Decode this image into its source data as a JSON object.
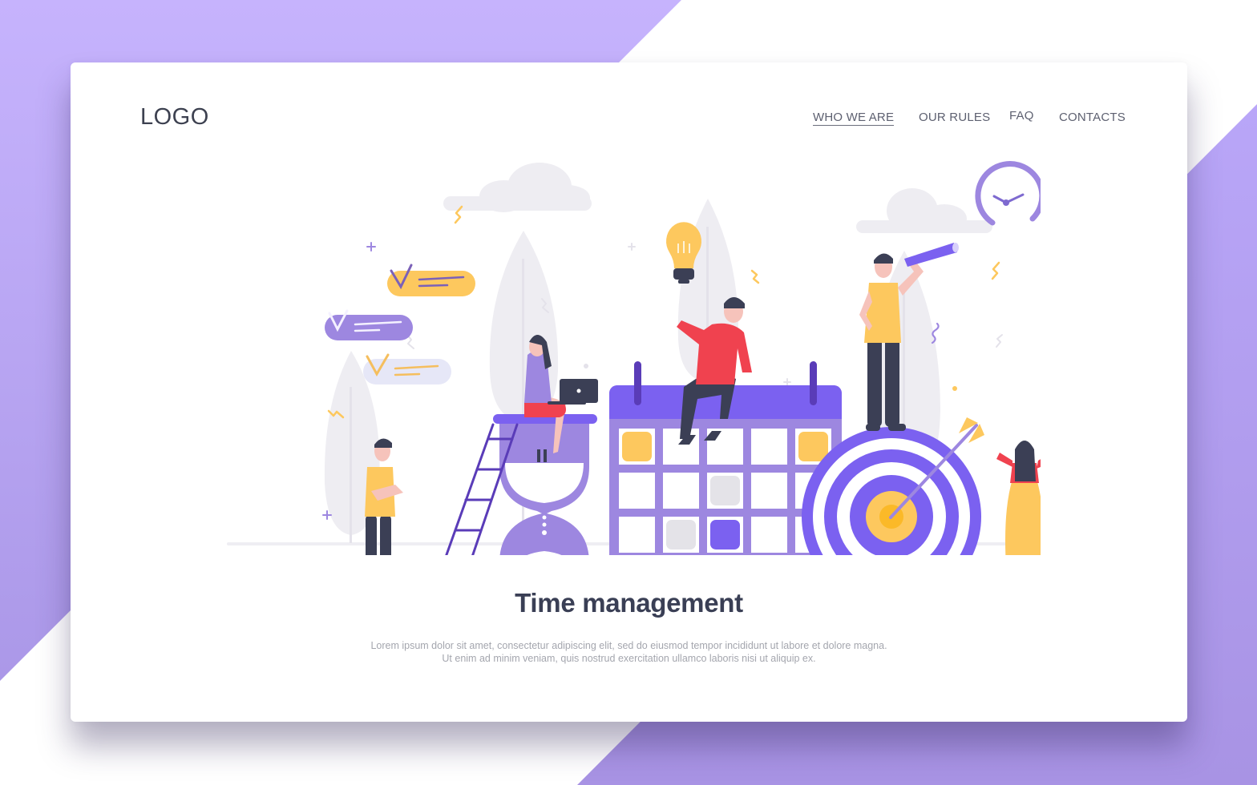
{
  "page": {
    "background_colors": {
      "top_left": "#c5b2fc",
      "bottom_right": "#a995e6",
      "white": "#ffffff"
    }
  },
  "header": {
    "logo": "LOGO",
    "nav": [
      {
        "label": "WHO WE ARE",
        "active": true
      },
      {
        "label": "OUR RULES",
        "active": false
      },
      {
        "label": "FAQ",
        "active": false
      },
      {
        "label": "CONTACTS",
        "active": false
      }
    ]
  },
  "illustration": {
    "description": "Time management flat illustration with calendar, hourglass, target, clock and people",
    "colors": {
      "primary": "#7b61f0",
      "primary_light": "#9d87e0",
      "primary_dark": "#5a3cb8",
      "yellow": "#fdc85e",
      "red": "#f0424f",
      "gray_light": "#eceaf0",
      "navy": "#3b3f55",
      "skin": "#f6c3bb"
    },
    "checklist_items": [
      {
        "color": "yellow"
      },
      {
        "color": "purple"
      },
      {
        "color": "light-blue"
      }
    ],
    "calendar_cells": [
      [
        "yellow",
        "white",
        "white",
        "white",
        "yellow"
      ],
      [
        "white",
        "white",
        "gray",
        "white",
        "white"
      ],
      [
        "white",
        "gray",
        "purple",
        "white",
        "white"
      ],
      [
        "purple",
        "white",
        "white",
        "yellow",
        "gray"
      ]
    ]
  },
  "hero": {
    "title": "Time management",
    "text_line1": "Lorem ipsum dolor sit amet, consectetur adipiscing elit, sed do eiusmod tempor incididunt ut labore et dolore magna.",
    "text_line2": "Ut enim ad minim veniam, quis nostrud exercitation ullamco laboris nisi ut aliquip ex."
  }
}
